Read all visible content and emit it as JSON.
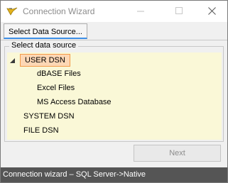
{
  "window": {
    "title": "Connection Wizard"
  },
  "tabs": [
    {
      "label": "Select Data Source..."
    }
  ],
  "group": {
    "label": "Select data source"
  },
  "tree": {
    "root_selected": "USER DSN",
    "children": [
      "dBASE Files",
      "Excel Files",
      "MS Access Database"
    ],
    "others": [
      "SYSTEM DSN",
      "FILE DSN"
    ]
  },
  "buttons": {
    "next_label": "Next"
  },
  "status": {
    "text": "Connection wizard –  SQL Server->Native"
  },
  "colors": {
    "title_text": "#8c8c8c",
    "tab_accent": "#3d8ee6",
    "tree_background": "#faf8d7",
    "selection_fill": "#fdd7b5",
    "selection_border": "#f39b4a",
    "statusbar": "#555555"
  },
  "icons": {
    "app": "app-logo-icon",
    "minimize": "minimize-icon",
    "maximize": "maximize-icon",
    "close": "close-icon",
    "expander": "tree-expanded-triangle-icon"
  }
}
